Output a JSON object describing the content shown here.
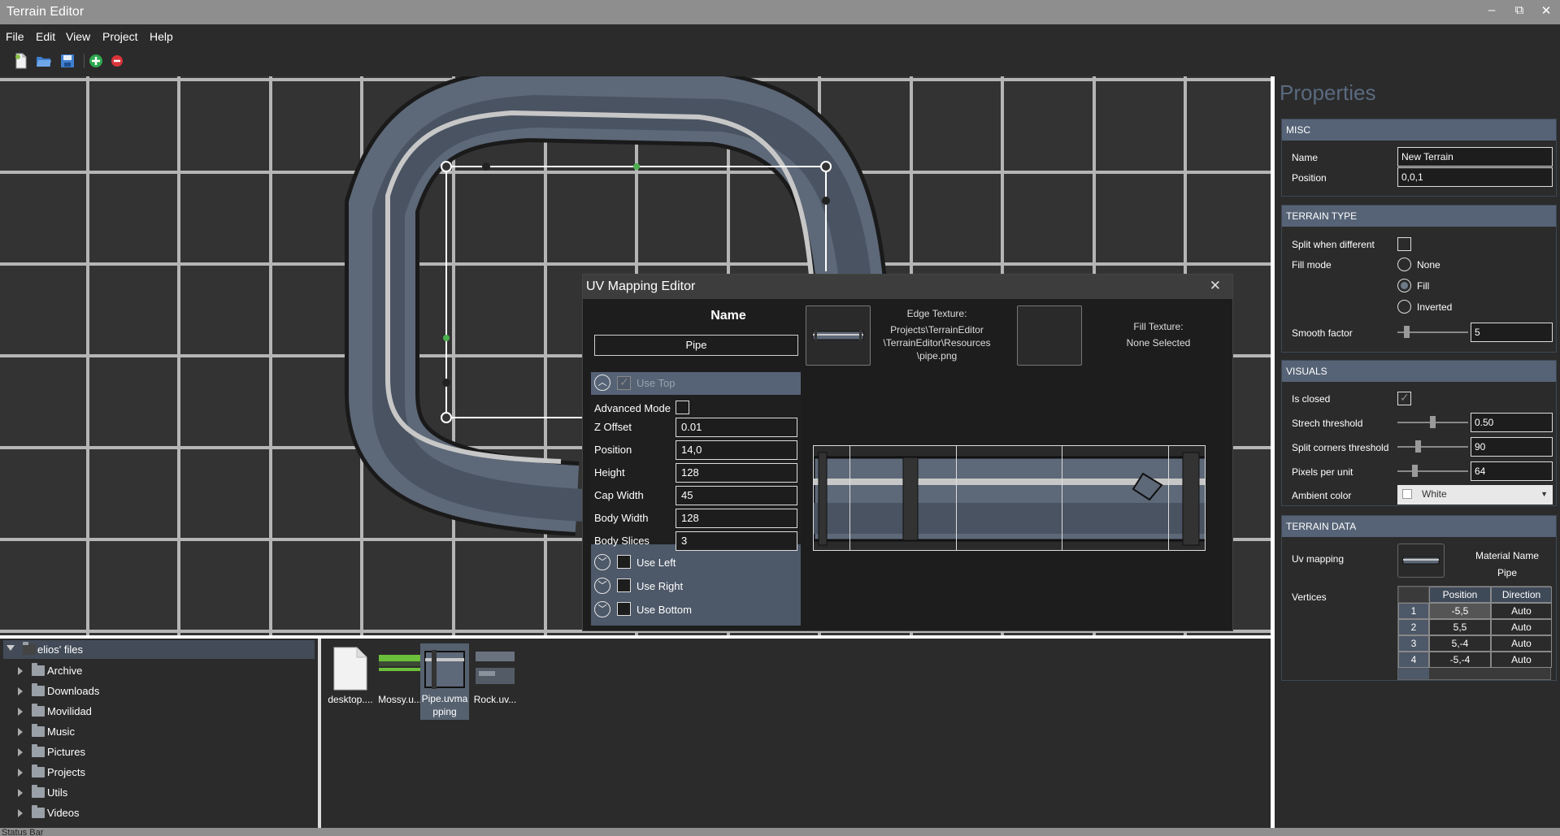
{
  "app": {
    "title": "Terrain Editor",
    "window_controls": [
      "–",
      "⧉",
      "✕"
    ]
  },
  "menu": [
    "File",
    "Edit",
    "View",
    "Project",
    "Help"
  ],
  "toolbar": {
    "icons": [
      "new-file-icon",
      "open-folder-icon",
      "save-icon",
      "add-icon",
      "remove-icon"
    ],
    "colors": {
      "add": "#2fa84f",
      "remove": "#d9343a"
    }
  },
  "uv_editor": {
    "title": "UV Mapping Editor",
    "close": "✕",
    "name_label": "Name",
    "name_value": "Pipe",
    "edge_texture_label": "Edge Texture:",
    "edge_texture_path": [
      "Projects\\TerrainEditor",
      "\\TerrainEditor\\Resources",
      "\\pipe.png"
    ],
    "fill_texture_label": "Fill Texture:",
    "fill_texture_value": "None Selected",
    "sections": {
      "use_top": "Use Top",
      "use_left": "Use Left",
      "use_right": "Use Right",
      "use_bottom": "Use Bottom"
    },
    "fields": [
      {
        "label": "Advanced Mode",
        "type": "checkbox"
      },
      {
        "label": "Z Offset",
        "value": "0.01"
      },
      {
        "label": "Position",
        "value": "14,0"
      },
      {
        "label": "Height",
        "value": "128"
      },
      {
        "label": "Cap Width",
        "value": "45"
      },
      {
        "label": "Body Width",
        "value": "128"
      },
      {
        "label": "Body Slices",
        "value": "3"
      }
    ]
  },
  "file_tree": {
    "root": "elios' files",
    "folders": [
      "Archive",
      "Downloads",
      "Movilidad",
      "Music",
      "Pictures",
      "Projects",
      "Utils",
      "Videos"
    ]
  },
  "files": [
    {
      "name": "desktop...."
    },
    {
      "name": "Mossy.u..."
    },
    {
      "name": "Pipe.uvma pping",
      "selected": true
    },
    {
      "name": "Rock.uv..."
    }
  ],
  "status": "Status Bar",
  "properties": {
    "title": "Properties",
    "misc": {
      "header": "MISC",
      "name_label": "Name",
      "name_value": "New Terrain",
      "position_label": "Position",
      "position_value": "0,0,1"
    },
    "terrain_type": {
      "header": "TERRAIN TYPE",
      "split_label": "Split when different",
      "fill_mode_label": "Fill mode",
      "fill_options": [
        "None",
        "Fill",
        "Inverted"
      ],
      "fill_selected": "Fill",
      "smooth_label": "Smooth factor",
      "smooth_value": "5"
    },
    "visuals": {
      "header": "VISUALS",
      "closed_label": "Is closed",
      "strech_label": "Strech threshold",
      "strech_value": "0.50",
      "split_corners_label": "Split corners threshold",
      "split_corners_value": "90",
      "ppu_label": "Pixels per unit",
      "ppu_value": "64",
      "ambient_label": "Ambient color",
      "ambient_value": "White"
    },
    "terrain_data": {
      "header": "TERRAIN DATA",
      "uv_label": "Uv mapping",
      "material_label": "Material Name",
      "material_value": "Pipe",
      "vertices_label": "Vertices",
      "columns": [
        "Position",
        "Direction"
      ],
      "rows": [
        {
          "n": "1",
          "position": "-5,5",
          "direction": "Auto"
        },
        {
          "n": "2",
          "position": "5,5",
          "direction": "Auto"
        },
        {
          "n": "3",
          "position": "5,-4",
          "direction": "Auto"
        },
        {
          "n": "4",
          "position": "-5,-4",
          "direction": "Auto"
        }
      ]
    }
  }
}
